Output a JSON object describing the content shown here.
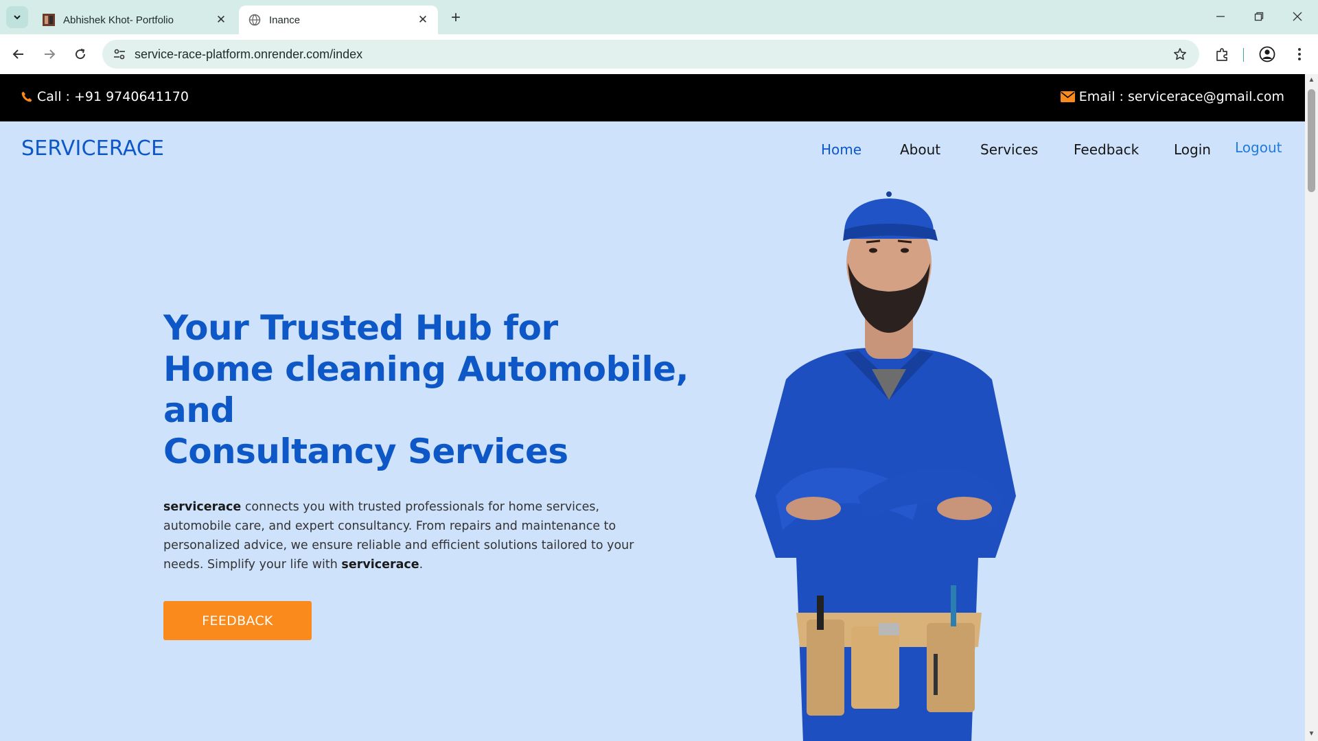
{
  "browser": {
    "tabs": [
      {
        "title": "Abhishek Khot- Portfolio",
        "active": false
      },
      {
        "title": "Inance",
        "active": true
      }
    ],
    "url": "service-race-platform.onrender.com/index",
    "icons": {
      "tab_search": "chevron-down-icon",
      "new_tab": "plus-icon",
      "back": "arrow-left-icon",
      "forward": "arrow-right-icon",
      "reload": "reload-icon",
      "site_info": "tune-icon",
      "bookmark": "star-icon",
      "extensions": "puzzle-icon",
      "profile": "account-icon",
      "menu": "kebab-menu-icon"
    }
  },
  "topbar": {
    "call": "Call : +91 9740641170",
    "email": "Email : servicerace@gmail.com"
  },
  "nav": {
    "brand": "SERVICERACE",
    "links": [
      "Home",
      "About",
      "Services",
      "Feedback",
      "Login",
      "Logout"
    ]
  },
  "hero": {
    "title_lines": [
      "Your Trusted Hub for",
      "Home cleaning Automobile,",
      "and",
      "Consultancy Services"
    ],
    "desc_brand": "servicerace",
    "desc_text": " connects you with trusted professionals for home services, automobile care, and expert consultancy. From repairs and maintenance to personalized advice, we ensure reliable and efficient solutions tailored to your needs. Simplify your life with ",
    "desc_brand_end": "servicerace",
    "desc_end": ".",
    "cta": "FEEDBACK"
  },
  "colors": {
    "accent_blue": "#0d57c6",
    "cta_orange": "#fb8a1c",
    "page_bg": "#cfe2fb",
    "topbar_bg": "#000000"
  }
}
